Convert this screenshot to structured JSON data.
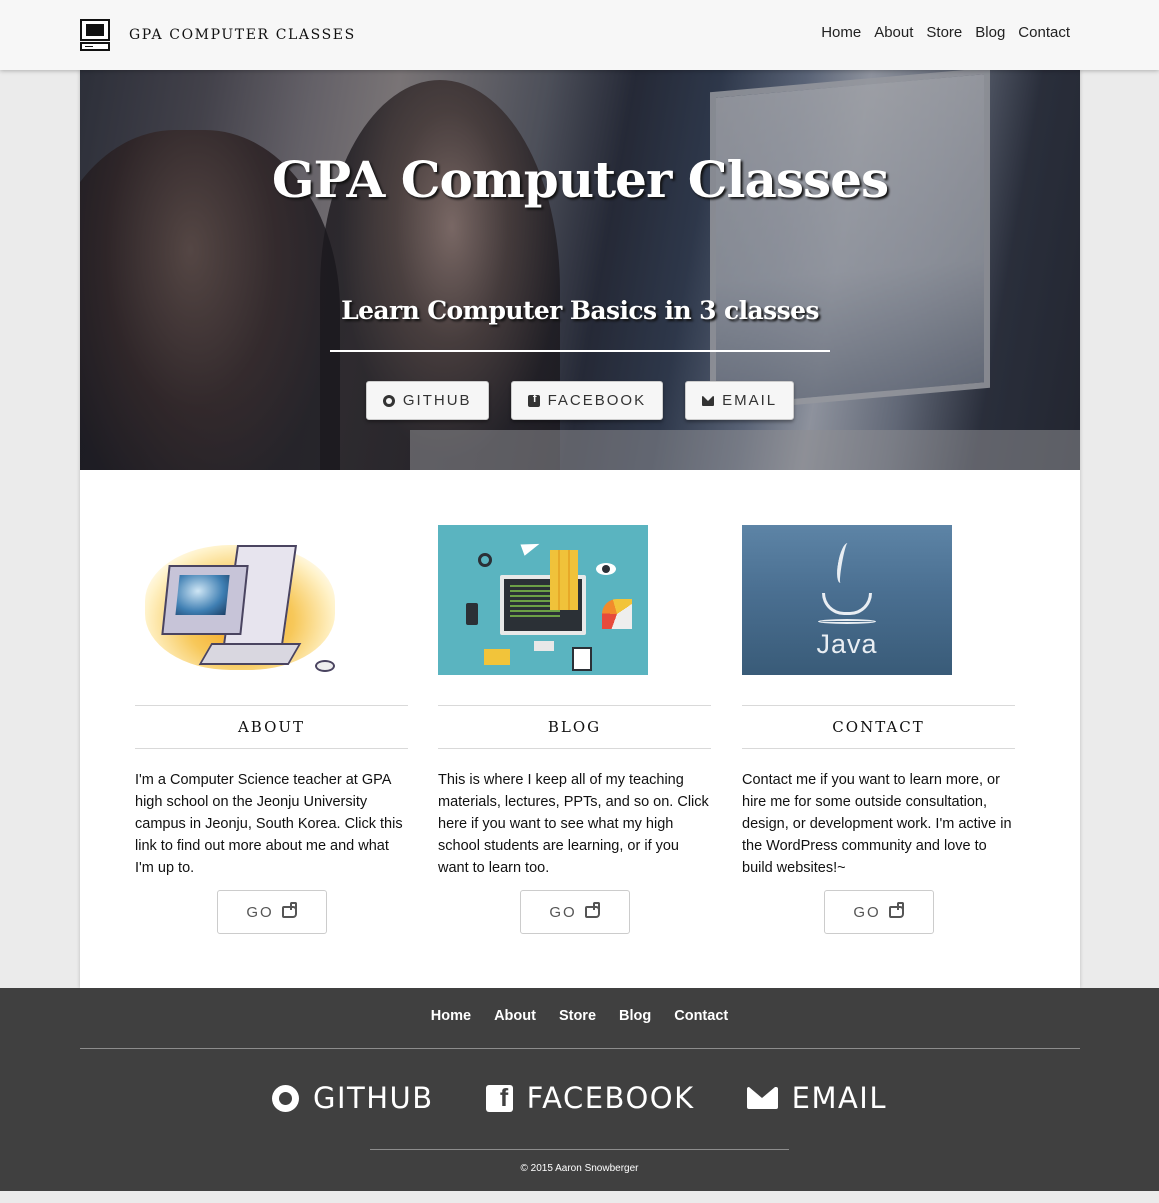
{
  "header": {
    "brand": "GPA COMPUTER CLASSES",
    "nav": [
      "Home",
      "About",
      "Store",
      "Blog",
      "Contact"
    ]
  },
  "hero": {
    "title": "GPA Computer Classes",
    "subtitle": "Learn Computer Basics in 3 classes",
    "buttons": [
      {
        "label": "GITHUB",
        "icon": "github-icon"
      },
      {
        "label": "FACEBOOK",
        "icon": "facebook-icon"
      },
      {
        "label": "EMAIL",
        "icon": "envelope-icon"
      }
    ]
  },
  "columns": [
    {
      "title": "ABOUT",
      "text": "I'm a Computer Science teacher at GPA high school on the Jeonju University campus in Jeonju, South Korea. Click this link to find out more about me and what I'm up to.",
      "button": "GO",
      "image": "computer-illustration"
    },
    {
      "title": "BLOG",
      "text": "This is where I keep all of my teaching materials, lectures, PPTs, and so on. Click here if you want to see what my high school students are learning, or if you want to learn too.",
      "button": "GO",
      "image": "web-design-illustration"
    },
    {
      "title": "CONTACT",
      "text": "Contact me if you want to learn more, or hire me for some outside consultation, design, or development work. I'm active in the WordPress community and love to build websites!~",
      "button": "GO",
      "image": "java-logo",
      "image_text": "Java"
    }
  ],
  "footer": {
    "nav": [
      "Home",
      "About",
      "Store",
      "Blog",
      "Contact"
    ],
    "social": [
      {
        "label": "GITHUB",
        "icon": "github-icon"
      },
      {
        "label": "FACEBOOK",
        "icon": "facebook-icon"
      },
      {
        "label": "EMAIL",
        "icon": "envelope-icon"
      }
    ],
    "copyright": "© 2015 Aaron Snowberger"
  },
  "colors": {
    "page_bg": "#ebebeb",
    "navbar_bg": "#f7f7f7",
    "footer_bg": "#404040",
    "text": "#222222"
  }
}
